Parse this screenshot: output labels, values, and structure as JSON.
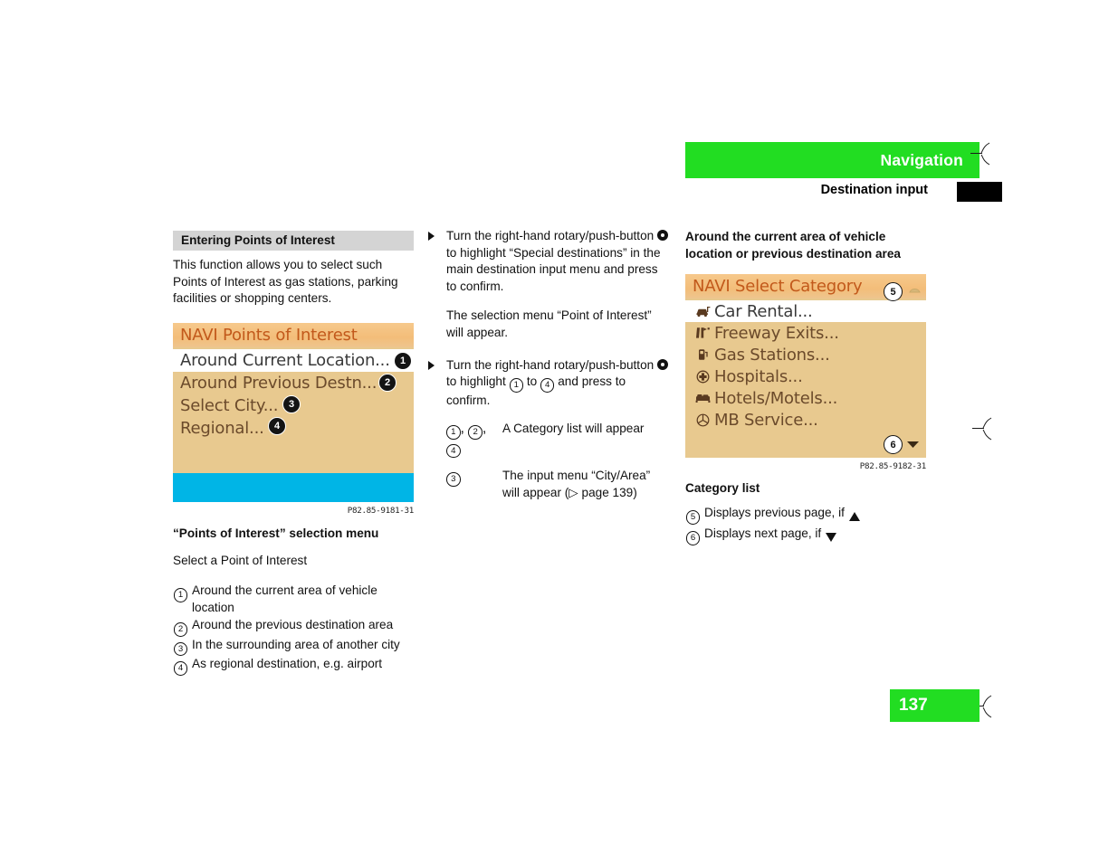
{
  "header": {
    "title": "Navigation",
    "subtitle": "Destination input",
    "green": "#22dd22"
  },
  "page_number": "137",
  "col1": {
    "section_heading": "Entering Points of Interest",
    "intro": "This function allows you to select such Points of Interest as gas stations, parking facilities or shopping centers.",
    "navi": {
      "header": "NAVI Points of Interest",
      "rows": [
        {
          "label": "Around Current Location...",
          "selected": true,
          "marker": "1"
        },
        {
          "label": "Around Previous Destn...",
          "selected": false,
          "marker": "2"
        },
        {
          "label": "Select City...",
          "selected": false,
          "marker": "3"
        },
        {
          "label": "Regional...",
          "selected": false,
          "marker": "4"
        }
      ]
    },
    "figure_id": "P82.85-9181-31",
    "figure_caption": "“Points of Interest” selection menu",
    "figure_note": "Select a Point of Interest",
    "legend": [
      {
        "num": "1",
        "text": "Around the current area of vehicle location"
      },
      {
        "num": "2",
        "text": "Around the previous destination area"
      },
      {
        "num": "3",
        "text": "In the surrounding area of another city"
      },
      {
        "num": "4",
        "text": "As regional destination, e.g. airport"
      }
    ]
  },
  "col2": {
    "step1_a": "Turn the right-hand rotary/push-button",
    "step1_b": "to highlight “Special destinations” in the main destination input menu and press to confirm.",
    "result1": "The selection menu “Point of Interest” will appear.",
    "step2_a": "Turn the right-hand rotary/push-button",
    "step2_b": "to highlight",
    "step2_c": "to",
    "step2_d": "and press to confirm.",
    "step2_num_from": "1",
    "step2_num_to": "4",
    "sub1_nums": [
      "1",
      "2",
      "4"
    ],
    "sub1_text": "A Category list will appear",
    "sub2_num": "3",
    "sub2_text": "The input menu “City/Area” will appear (▷ page 139)"
  },
  "col3": {
    "heading": "Around the current area of vehicle location or previous destination area",
    "navi": {
      "header": "NAVI Select Category",
      "rows": [
        {
          "icon": "car-rental-icon",
          "label": "Car Rental...",
          "selected": true
        },
        {
          "icon": "freeway-exit-icon",
          "label": "Freeway Exits...",
          "selected": false
        },
        {
          "icon": "gas-pump-icon",
          "label": "Gas Stations...",
          "selected": false
        },
        {
          "icon": "hospital-icon",
          "label": "Hospitals...",
          "selected": false
        },
        {
          "icon": "hotel-bed-icon",
          "label": "Hotels/Motels...",
          "selected": false
        },
        {
          "icon": "mercedes-star-icon",
          "label": "MB Service...",
          "selected": false
        }
      ],
      "marker_prev": "5",
      "marker_next": "6"
    },
    "figure_id": "P82.85-9182-31",
    "figure_caption": "Category list",
    "legend": [
      {
        "num": "5",
        "text": "Displays previous page, if",
        "arrow": "up"
      },
      {
        "num": "6",
        "text": "Displays next page, if",
        "arrow": "down"
      }
    ]
  }
}
